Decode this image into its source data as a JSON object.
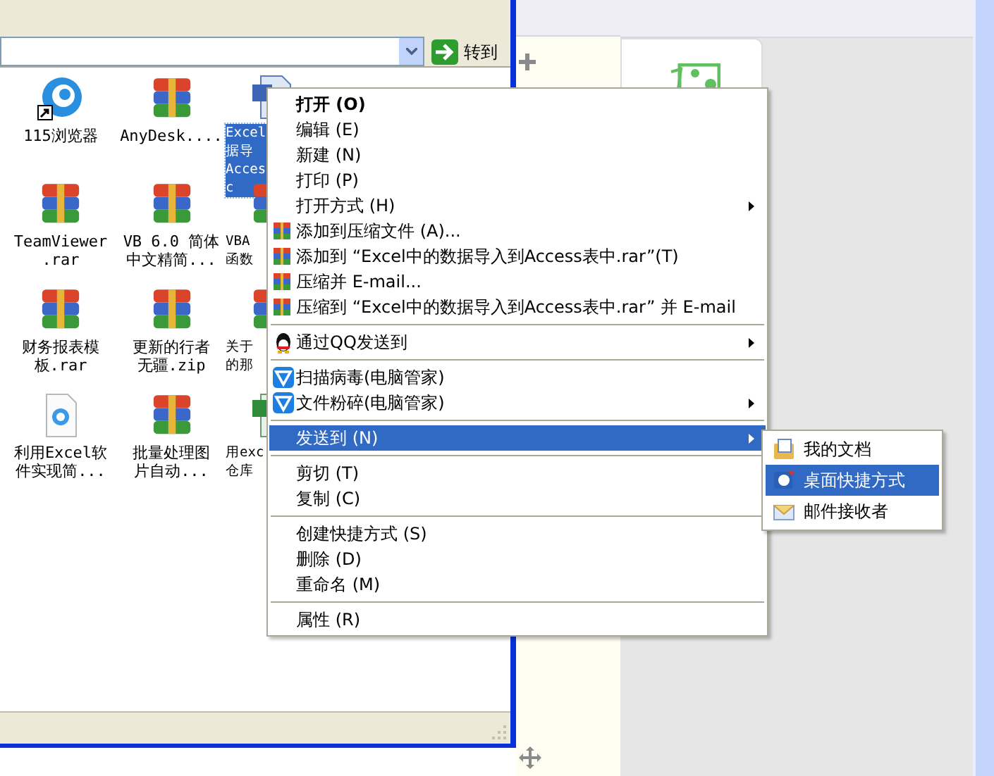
{
  "address_bar": {
    "go_button": "转到"
  },
  "files": [
    {
      "kind": "browser",
      "lines": [
        "115浏览器"
      ],
      "selected": false
    },
    {
      "kind": "archive",
      "lines": [
        "AnyDesk...."
      ],
      "selected": false
    },
    {
      "kind": "word",
      "lines": [
        "Excel",
        "据导",
        "Acces",
        "c"
      ],
      "selected": true
    },
    {
      "kind": "archive",
      "lines": [
        "TeamViewer",
        ".rar"
      ],
      "selected": false
    },
    {
      "kind": "archive",
      "lines": [
        "VB 6.0 简体",
        "中文精简..."
      ],
      "selected": false
    },
    {
      "kind": "archive",
      "lines": [
        "VBA",
        "函数"
      ],
      "selected": false
    },
    {
      "kind": "archive",
      "lines": [
        "财务报表模",
        "板.rar"
      ],
      "selected": false
    },
    {
      "kind": "archive",
      "lines": [
        "更新的行者",
        "无疆.zip"
      ],
      "selected": false
    },
    {
      "kind": "archive",
      "lines": [
        "关于",
        "的那"
      ],
      "selected": false
    },
    {
      "kind": "document",
      "lines": [
        "利用Excel软",
        "件实现简..."
      ],
      "selected": false
    },
    {
      "kind": "archive",
      "lines": [
        "批量处理图",
        "片自动..."
      ],
      "selected": false
    },
    {
      "kind": "excel",
      "lines": [
        "用exc",
        "仓库"
      ],
      "selected": false
    }
  ],
  "context_menu": {
    "groups": [
      [
        {
          "kind": "plain",
          "label": "打开 (O)",
          "bold": true,
          "submenu": false,
          "selected": false
        },
        {
          "kind": "plain",
          "label": "编辑 (E)",
          "bold": false,
          "submenu": false,
          "selected": false
        },
        {
          "kind": "plain",
          "label": "新建 (N)",
          "bold": false,
          "submenu": false,
          "selected": false
        },
        {
          "kind": "plain",
          "label": "打印 (P)",
          "bold": false,
          "submenu": false,
          "selected": false
        },
        {
          "kind": "plain",
          "label": "打开方式 (H)",
          "bold": false,
          "submenu": true,
          "selected": false
        },
        {
          "kind": "archive",
          "label": "添加到压缩文件 (A)...",
          "bold": false,
          "submenu": false,
          "selected": false
        },
        {
          "kind": "archive",
          "label": "添加到 “Excel中的数据导入到Access表中.rar”(T)",
          "bold": false,
          "submenu": false,
          "selected": false
        },
        {
          "kind": "archive",
          "label": "压缩并 E-mail...",
          "bold": false,
          "submenu": false,
          "selected": false
        },
        {
          "kind": "archive",
          "label": "压缩到 “Excel中的数据导入到Access表中.rar” 并 E-mail",
          "bold": false,
          "submenu": false,
          "selected": false
        }
      ],
      [
        {
          "kind": "qq",
          "label": "通过QQ发送到",
          "bold": false,
          "submenu": true,
          "selected": false
        }
      ],
      [
        {
          "kind": "guard",
          "label": "扫描病毒(电脑管家)",
          "bold": false,
          "submenu": false,
          "selected": false
        },
        {
          "kind": "guard",
          "label": "文件粉碎(电脑管家)",
          "bold": false,
          "submenu": true,
          "selected": false
        }
      ],
      [
        {
          "kind": "plain",
          "label": "发送到 (N)",
          "bold": false,
          "submenu": true,
          "selected": true
        }
      ],
      [
        {
          "kind": "plain",
          "label": "剪切 (T)",
          "bold": false,
          "submenu": false,
          "selected": false
        },
        {
          "kind": "plain",
          "label": "复制 (C)",
          "bold": false,
          "submenu": false,
          "selected": false
        }
      ],
      [
        {
          "kind": "plain",
          "label": "创建快捷方式 (S)",
          "bold": false,
          "submenu": false,
          "selected": false
        },
        {
          "kind": "plain",
          "label": "删除 (D)",
          "bold": false,
          "submenu": false,
          "selected": false
        },
        {
          "kind": "plain",
          "label": "重命名 (M)",
          "bold": false,
          "submenu": false,
          "selected": false
        }
      ],
      [
        {
          "kind": "plain",
          "label": "属性 (R)",
          "bold": false,
          "submenu": false,
          "selected": false
        }
      ]
    ]
  },
  "send_to_menu": {
    "items": [
      {
        "kind": "documents",
        "label": "我的文档",
        "selected": false
      },
      {
        "kind": "desktop",
        "label": "桌面快捷方式",
        "selected": true
      },
      {
        "kind": "mail",
        "label": "邮件接收者",
        "selected": false
      }
    ]
  }
}
